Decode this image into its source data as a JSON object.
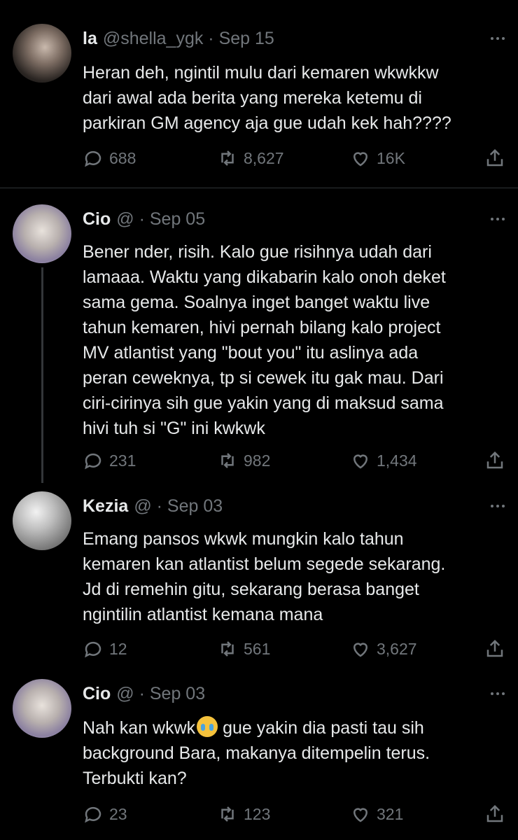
{
  "tweets": [
    {
      "name": "la",
      "meta": "@shella_ygk · Sep 15",
      "avatar": "avatar-photo",
      "text": "Heran deh, ngintil mulu dari kemaren wkwkkw\ndari awal ada berita yang mereka ketemu di\nparkiran GM agency aja gue udah kek hah????",
      "replies": "688",
      "retweets": "8,627",
      "likes": "16K"
    },
    {
      "name": "Cio",
      "meta": "@ · Sep 05",
      "avatar": "avatar-photo",
      "text": "Bener nder, risih. Kalo gue risihnya udah dari\nlamaaa. Waktu yang dikabarin kalo onoh deket\nsama gema. Soalnya inget banget waktu live\ntahun kemaren, hivi pernah bilang kalo project\nMV atlantist yang \"bout you\" itu aslinya ada\nperan ceweknya, tp si cewek itu gak mau. Dari\nciri-cirinya sih gue yakin yang di maksud sama\nhivi tuh si \"G\" ini kwkwk",
      "replies": "231",
      "retweets": "982",
      "likes": "1,434"
    },
    {
      "name": "Kezia",
      "meta": "@ · Sep 03",
      "avatar": "avatar-photo",
      "text": "Emang pansos wkwk mungkin kalo tahun\nkemaren kan atlantist belum segede sekarang.\nJd di remehin gitu, sekarang berasa banget\nngintilin atlantist kemana mana",
      "replies": "12",
      "retweets": "561",
      "likes": "3,627"
    },
    {
      "name": "Cio",
      "meta": "@ · Sep 03",
      "avatar": "avatar-photo",
      "text_before_emoji": "Nah kan wkwk",
      "emoji": "crying-face-emoji",
      "text_after_emoji": " gue yakin dia pasti tau sih\nbackground Bara, makanya ditempelin terus.\nTerbukti kan?",
      "replies": "23",
      "retweets": "123",
      "likes": "321"
    }
  ],
  "icons": {
    "reply": "reply-icon",
    "retweet": "retweet-icon",
    "like": "heart-icon",
    "share": "share-icon",
    "more": "more-icon"
  },
  "colors": {
    "background": "#000000",
    "text": "#e7e9ea",
    "secondary": "#71767b",
    "divider": "#2f3336"
  }
}
